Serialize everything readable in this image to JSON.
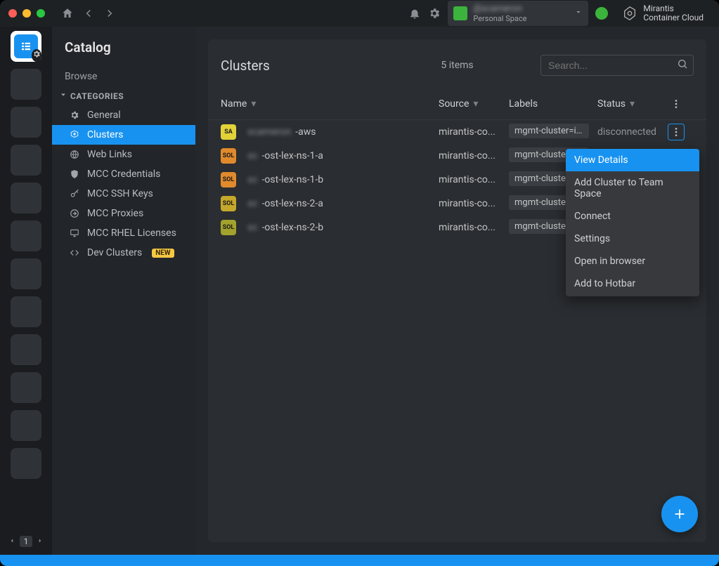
{
  "titlebar": {
    "user_handle": "@scameron",
    "user_space": "Personal Space",
    "brand_line1": "Mirantis",
    "brand_line2": "Container Cloud"
  },
  "hotbar": {
    "pager_current": "1"
  },
  "sidebar": {
    "title": "Catalog",
    "browse": "Browse",
    "section": "CATEGORIES",
    "items": [
      {
        "label": "General",
        "icon": "gear"
      },
      {
        "label": "Clusters",
        "icon": "kube",
        "active": true
      },
      {
        "label": "Web Links",
        "icon": "globe"
      },
      {
        "label": "MCC Credentials",
        "icon": "shield"
      },
      {
        "label": "MCC SSH Keys",
        "icon": "key"
      },
      {
        "label": "MCC Proxies",
        "icon": "proxy"
      },
      {
        "label": "MCC RHEL Licenses",
        "icon": "display"
      },
      {
        "label": "Dev Clusters",
        "icon": "code",
        "badge": "NEW"
      }
    ]
  },
  "table": {
    "title": "Clusters",
    "count_label": "5 items",
    "search_placeholder": "Search...",
    "columns": {
      "name": "Name",
      "source": "Source",
      "labels": "Labels",
      "status": "Status"
    },
    "rows": [
      {
        "badge": "SA",
        "badge_color": "#e2d23a",
        "name_blur": "scameron",
        "name_suffix": "-aws",
        "source": "mirantis-co...",
        "label": "mgmt-cluster=icc",
        "status": "disconnected",
        "kebab_active": true
      },
      {
        "badge": "SOL",
        "badge_color": "#e08a2c",
        "name_blur": "sc",
        "name_suffix": "-ost-lex-ns-1-a",
        "source": "mirantis-co...",
        "label": "mgmt-cluster=sol",
        "status": ""
      },
      {
        "badge": "SOL",
        "badge_color": "#e08a2c",
        "name_blur": "sc",
        "name_suffix": "-ost-lex-ns-1-b",
        "source": "mirantis-co...",
        "label": "mgmt-cluster=sol",
        "status": ""
      },
      {
        "badge": "SOL",
        "badge_color": "#c4a82c",
        "name_blur": "sc",
        "name_suffix": "-ost-lex-ns-2-a",
        "source": "mirantis-co...",
        "label": "mgmt-cluster=sol",
        "status": ""
      },
      {
        "badge": "SOL",
        "badge_color": "#a2a22c",
        "name_blur": "sc",
        "name_suffix": "-ost-lex-ns-2-b",
        "source": "mirantis-co...",
        "label": "mgmt-cluster=sol",
        "status": ""
      }
    ]
  },
  "context_menu": {
    "items": [
      "View Details",
      "Add Cluster to Team Space",
      "Connect",
      "Settings",
      "Open in browser",
      "Add to Hotbar"
    ],
    "selected_index": 0
  }
}
